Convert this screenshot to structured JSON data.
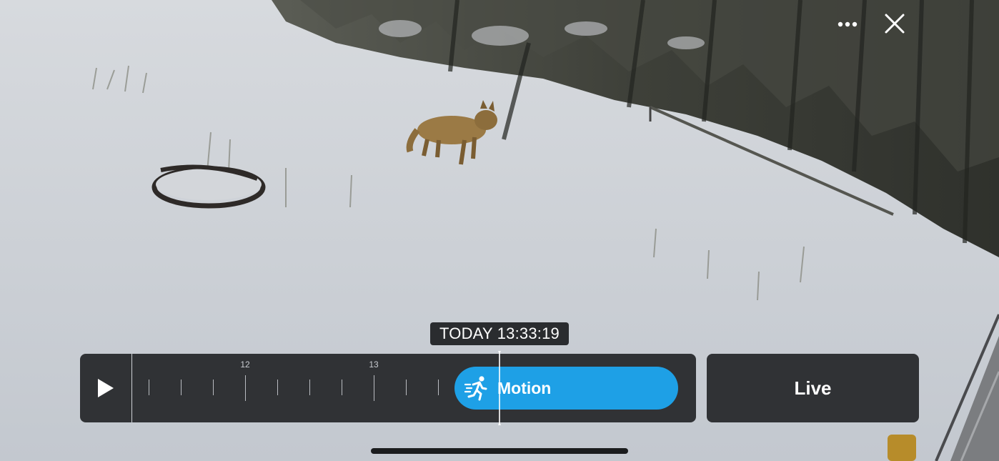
{
  "header": {
    "more_icon": "ellipsis-icon",
    "close_icon": "close-icon"
  },
  "player": {
    "timestamp": "TODAY 13:33:19",
    "play_icon": "play-icon",
    "timeline": {
      "hour_labels": [
        "12",
        "13"
      ],
      "event": {
        "label": "Motion",
        "icon": "running-person-icon",
        "color": "#1ea0e6"
      }
    },
    "live_label": "Live"
  },
  "scene": {
    "description_icon": "camera-feed"
  }
}
